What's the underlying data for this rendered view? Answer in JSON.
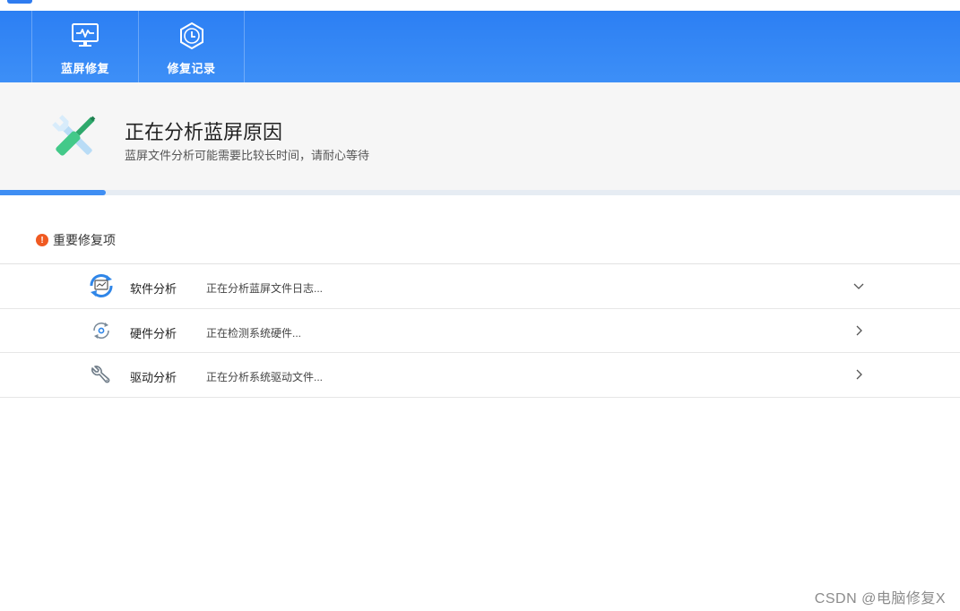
{
  "toolbar": {
    "items": [
      {
        "label": "蓝屏修复",
        "icon": "monitor-pulse-icon"
      },
      {
        "label": "修复记录",
        "icon": "clock-shield-icon"
      }
    ]
  },
  "status": {
    "title": "正在分析蓝屏原因",
    "subtitle": "蓝屏文件分析可能需要比较长时间，请耐心等待",
    "icon": "tools-repair-icon",
    "progress_percent": 11
  },
  "section": {
    "title": "重要修复项",
    "warn_mark": "!"
  },
  "rows": [
    {
      "name": "软件分析",
      "status": "正在分析蓝屏文件日志...",
      "icon": "software-refresh-icon",
      "expanded": true
    },
    {
      "name": "硬件分析",
      "status": "正在检测系统硬件...",
      "icon": "hardware-cycle-icon",
      "expanded": false
    },
    {
      "name": "驱动分析",
      "status": "正在分析系统驱动文件...",
      "icon": "wrench-icon",
      "expanded": false
    }
  ],
  "watermark": "CSDN @电脑修复X",
  "colors": {
    "accent": "#2c7ff3",
    "warning": "#f05a22",
    "progress": "#3f8ef3"
  }
}
